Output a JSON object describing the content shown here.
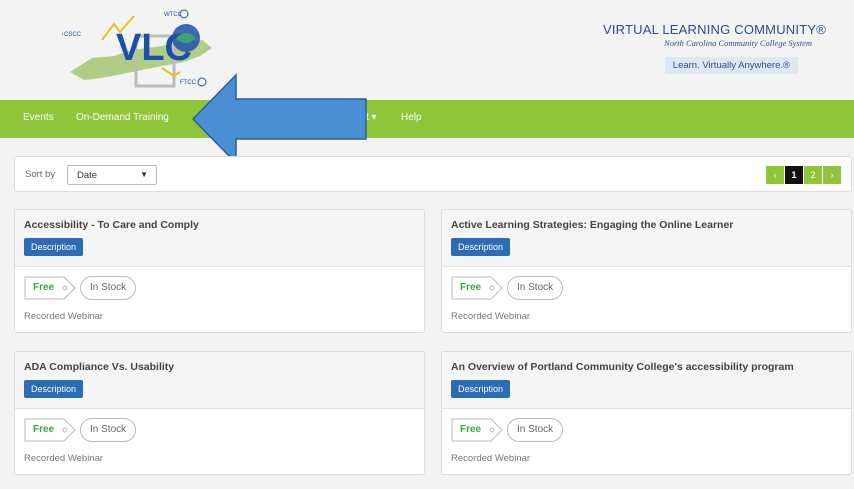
{
  "header": {
    "logo": {
      "main": "VLC",
      "top_badge": "WTCC",
      "left_badge": "CSCC",
      "right_badge": "FTCC"
    },
    "brand_title": "VIRTUAL LEARNING COMMUNITY®",
    "brand_subtitle": "North Carolina Community College System",
    "tagline": "Learn. Virtually Anywhere.®"
  },
  "nav": {
    "items": [
      {
        "label": "Events"
      },
      {
        "label": "On-Demand Training"
      },
      {
        "label": "t ▾"
      },
      {
        "label": "Help"
      }
    ]
  },
  "annotation": {
    "icon": "left-pointing-arrow",
    "color": "#4a8fd4"
  },
  "sort": {
    "label": "Sort by",
    "selected": "Date",
    "caret": "▼"
  },
  "pager": {
    "prev": "‹",
    "pages": [
      "1",
      "2"
    ],
    "current": "1",
    "next": "›"
  },
  "cards": [
    {
      "title": "Accessibility - To Care and Comply",
      "button": "Description",
      "price": "Free",
      "stock": "In Stock",
      "format": "Recorded Webinar"
    },
    {
      "title": "Active Learning Strategies: Engaging the Online Learner",
      "button": "Description",
      "price": "Free",
      "stock": "In Stock",
      "format": "Recorded Webinar"
    },
    {
      "title": "ADA Compliance Vs. Usability",
      "button": "Description",
      "price": "Free",
      "stock": "In Stock",
      "format": "Recorded Webinar"
    },
    {
      "title": "An Overview of Portland Community College's accessibility program",
      "button": "Description",
      "price": "Free",
      "stock": "In Stock",
      "format": "Recorded Webinar"
    }
  ],
  "colors": {
    "nav_green": "#8fc43b",
    "button_blue": "#2b6cb4",
    "price_green": "#3aa545",
    "brand_blue": "#2c4f8a"
  }
}
